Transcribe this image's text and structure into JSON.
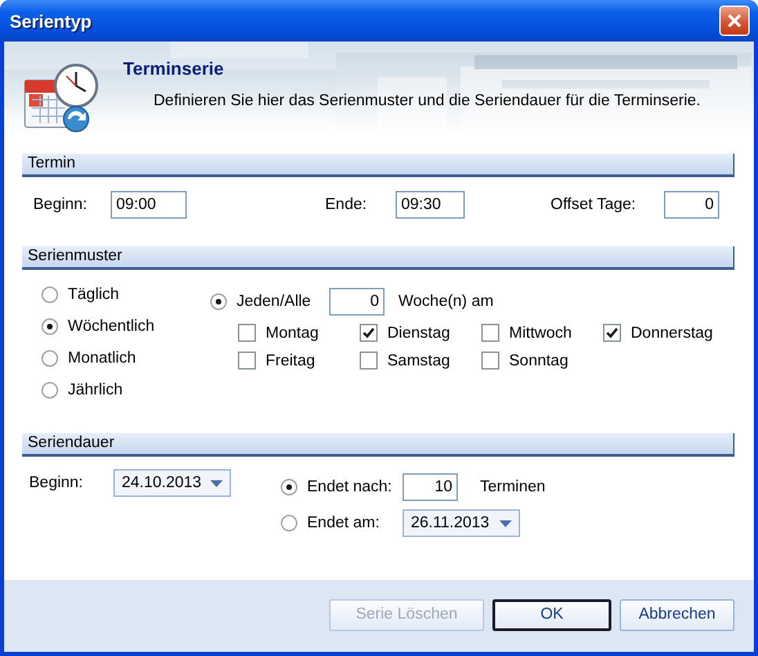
{
  "window": {
    "title": "Serientyp"
  },
  "header": {
    "title": "Terminserie",
    "description": "Definieren Sie hier das Serienmuster und die Seriendauer für die Terminserie."
  },
  "termin": {
    "title": "Termin",
    "fields": [
      {
        "label": "Beginn:",
        "value": "09:00"
      },
      {
        "label": "Ende:",
        "value": "09:30"
      },
      {
        "label": "Offset Tage:",
        "value": "0"
      }
    ]
  },
  "serienmuster": {
    "title": "Serienmuster",
    "frequencies": [
      {
        "label": "Täglich",
        "selected": false
      },
      {
        "label": "Wöchentlich",
        "selected": true
      },
      {
        "label": "Monatlich",
        "selected": false
      },
      {
        "label": "Jährlich",
        "selected": false
      }
    ],
    "interval": {
      "label": "Jeden/Alle",
      "selected": true,
      "value": "0",
      "unit": "Woche(n) am"
    },
    "weekdays": [
      {
        "label": "Montag",
        "checked": false
      },
      {
        "label": "Dienstag",
        "checked": true
      },
      {
        "label": "Mittwoch",
        "checked": false
      },
      {
        "label": "Donnerstag",
        "checked": true
      },
      {
        "label": "Freitag",
        "checked": false
      },
      {
        "label": "Samstag",
        "checked": false
      },
      {
        "label": "Sonntag",
        "checked": false
      }
    ]
  },
  "seriendauer": {
    "title": "Seriendauer",
    "start": {
      "label": "Beginn:",
      "value": "24.10.2013"
    },
    "end_options": [
      {
        "kind": "count",
        "label": "Endet nach:",
        "selected": true,
        "value": "10",
        "unit": "Terminen"
      },
      {
        "kind": "date",
        "label": "Endet am:",
        "selected": false,
        "value": "26.11.2013"
      }
    ]
  },
  "buttons": [
    {
      "label": "Serie Löschen",
      "disabled": true,
      "default": false
    },
    {
      "label": "OK",
      "disabled": false,
      "default": true
    },
    {
      "label": "Abbrechen",
      "disabled": false,
      "default": false
    }
  ]
}
